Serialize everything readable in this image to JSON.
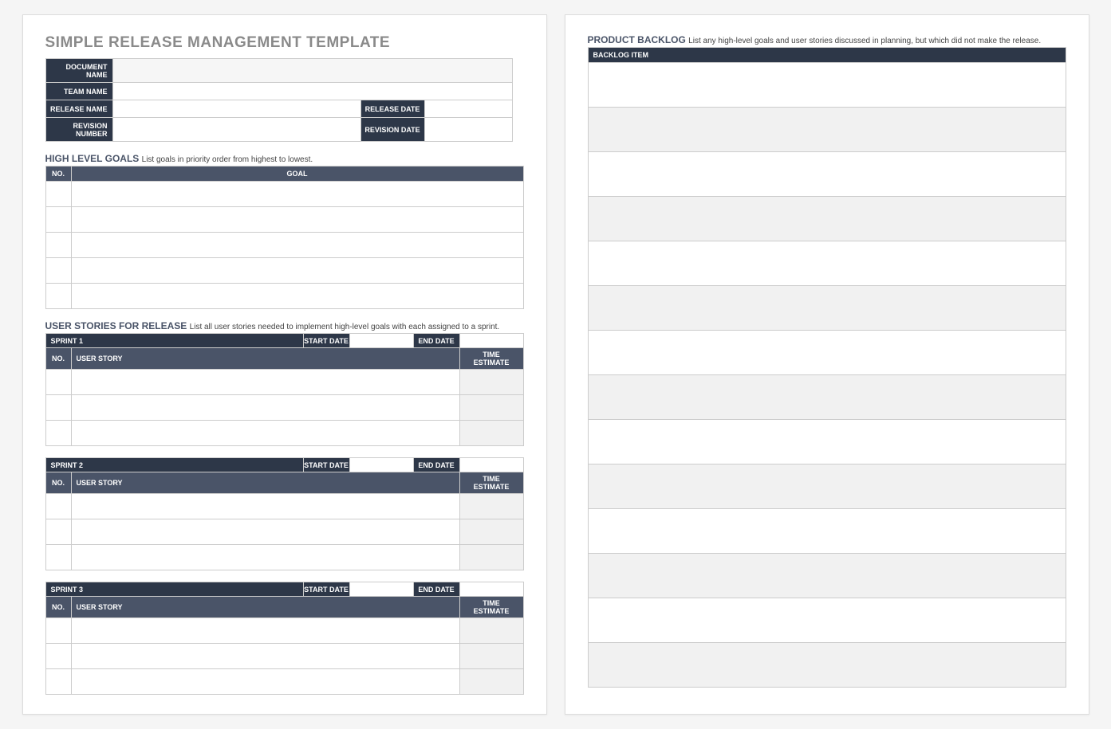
{
  "page1": {
    "title": "SIMPLE RELEASE MANAGEMENT TEMPLATE",
    "info": {
      "doc_name_label": "DOCUMENT NAME",
      "team_name_label": "TEAM NAME",
      "release_name_label": "RELEASE NAME",
      "release_date_label": "RELEASE DATE",
      "revision_number_label": "REVISION NUMBER",
      "revision_date_label": "REVISION DATE",
      "doc_name": "",
      "team_name": "",
      "release_name": "",
      "release_date": "",
      "revision_number": "",
      "revision_date": ""
    },
    "goals": {
      "heading": "HIGH LEVEL GOALS",
      "subtitle": "List goals in priority order from highest to lowest.",
      "col_no": "NO.",
      "col_goal": "GOAL"
    },
    "stories": {
      "heading": "USER STORIES FOR RELEASE",
      "subtitle": "List all user stories needed to implement high-level goals with each assigned to a sprint.",
      "start_date_label": "START DATE",
      "end_date_label": "END DATE",
      "col_no": "NO.",
      "col_story": "USER STORY",
      "col_time": "TIME ESTIMATE",
      "sprints": [
        {
          "name": "SPRINT 1",
          "start": "",
          "end": ""
        },
        {
          "name": "SPRINT 2",
          "start": "",
          "end": ""
        },
        {
          "name": "SPRINT 3",
          "start": "",
          "end": ""
        }
      ]
    }
  },
  "page2": {
    "backlog": {
      "heading": "PRODUCT BACKLOG",
      "subtitle": "List any high-level goals and user stories discussed in planning, but which did not make the release.",
      "col_item": "BACKLOG ITEM"
    }
  }
}
